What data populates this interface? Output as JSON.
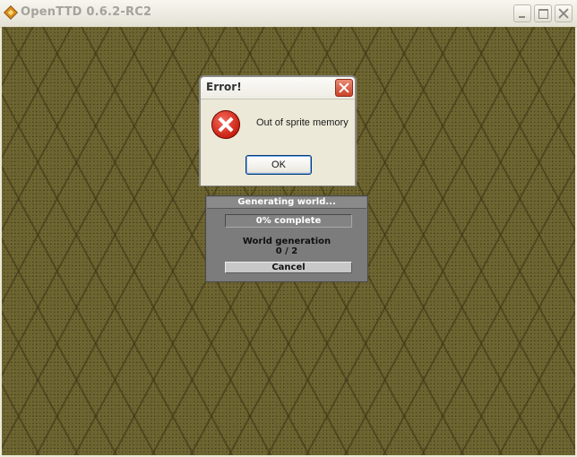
{
  "window": {
    "title": "OpenTTD 0.6.2-RC2",
    "icon": "openttd-app-icon"
  },
  "error_dialog": {
    "title": "Error!",
    "message": "Out of sprite memory",
    "icon": "error-icon",
    "ok_label": "OK"
  },
  "generation": {
    "caption": "Generating world...",
    "progress_text": "0% complete",
    "progress_percent": 0,
    "stage_label": "World generation",
    "stage_count": "0 / 2",
    "cancel_label": "Cancel"
  },
  "colors": {
    "terrain": "#6c6430",
    "panel_grey": "#7c7c7c",
    "error_red": "#c81e10"
  }
}
